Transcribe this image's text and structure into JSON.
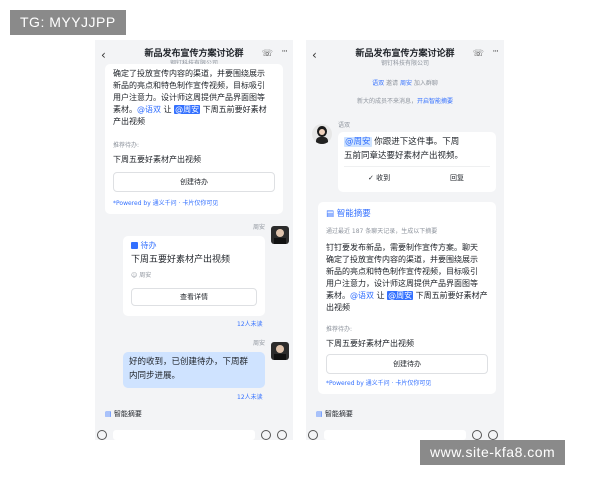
{
  "watermarks": {
    "top": "TG: MYYJJPP",
    "bottom": "www.site-kfa8.com"
  },
  "chat": {
    "title": "新品发布宣传方案讨论群",
    "subtitle": "钢钉科技有限公司"
  },
  "left": {
    "summary_lines": [
      "确定了投放宣传内容的渠道，并要围绕展示",
      "新品的亮点和特色制作宣传视频，目标吸引",
      "用户注意力。设计师这周提供产品界面图等"
    ],
    "summary_line4_pre": "素材。",
    "summary_mention1": "@语双",
    "summary_line4_mid": " 让 ",
    "summary_mention2": "@周安",
    "summary_line4_post": " 下周五前要好素材",
    "summary_line5": "产出视频",
    "todo_label": "推荐待办:",
    "todo_text": "下周五要好素材产出视频",
    "create_todo_btn": "创建待办",
    "powered_by": "*Powered by 通义千问 · 卡片仅你可见",
    "sender1": "周安",
    "task_tag": "待办",
    "task_title": "下周五要好素材产出视频",
    "task_assignee": "周安",
    "task_detail_btn": "查看详情",
    "read1": "12人未读",
    "sender2": "周安",
    "bubble_line1": "好的收到，已创建待办，下周群",
    "bubble_line2": "内同步进展。",
    "read2": "12人未读",
    "smart_summary": "智能摘要"
  },
  "right": {
    "sys1_name": "语双",
    "sys1_mid": " 邀请 ",
    "sys1_name2": "周安",
    "sys1_post": " 加入群聊",
    "sys2_pre": "新大的成员不来消息，",
    "sys2_link": "开启智能摘要",
    "sender": "语双",
    "msg_mention": "@周安",
    "msg_line1": " 你跟进下这件事。下周",
    "msg_line2": "五前同章达要好素材产出视频。",
    "received": "收到",
    "reply": "回复",
    "summary_title": "智能摘要",
    "summary_meta": "通过最近 187 条聊天记录，生成以下摘要",
    "summary_lines": [
      "钉钉要发布新品，需要制作宣传方案。聊天",
      "确定了投放宣传内容的渠道，并要围绕展示",
      "新品的亮点和特色制作宣传视频，目标吸引",
      "用户注意力，设计师这周提供产品界面图等"
    ],
    "summary_line5_pre": "素材。",
    "summary_mention1": "@语双",
    "summary_line5_mid": " 让 ",
    "summary_mention2": "@周安",
    "summary_line5_post": " 下周五前要好素材产",
    "summary_line6": "出视频",
    "todo_label": "推荐待办:",
    "todo_text": "下周五要好素材产出视频",
    "create_todo_btn": "创建待办",
    "powered_by": "*Powered by 通义千问 · 卡片仅你可见",
    "smart_summary": "智能摘要"
  },
  "icons": {
    "back": "chevron-left-icon",
    "call": "phone-icon",
    "more": "more-icon",
    "summary": "document-icon",
    "task": "checkbox-icon",
    "user": "user-icon",
    "emoji": "emoji-icon",
    "add": "plus-icon"
  },
  "colors": {
    "accent": "#3370ff",
    "bubble": "#cfe3ff",
    "bg": "#f3f4f6"
  }
}
